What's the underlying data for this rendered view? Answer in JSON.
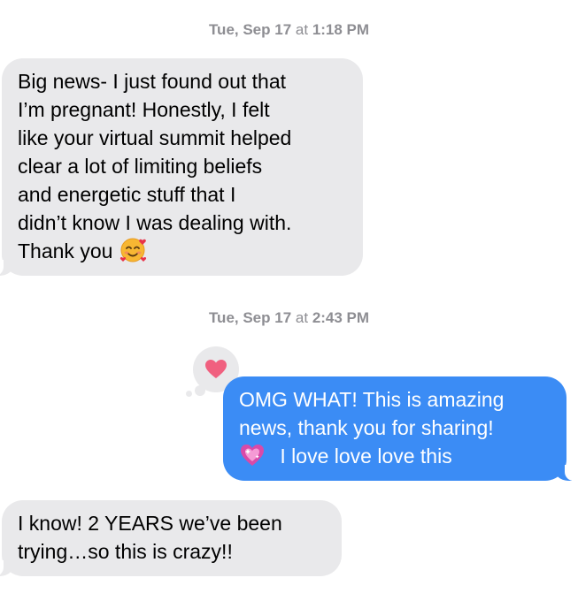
{
  "conversation": {
    "timestamps": [
      {
        "day": "Tue, Sep 17",
        "at": "at",
        "time": "1:18 PM"
      },
      {
        "day": "Tue, Sep 17",
        "at": "at",
        "time": "2:43 PM"
      }
    ],
    "messages": [
      {
        "direction": "received",
        "lines": [
          "Big news- I just found out that",
          "I’m pregnant! Honestly, I felt",
          "like your virtual summit helped",
          "clear a lot of limiting beliefs",
          "and energetic stuff that I",
          "didn’t know I was dealing with.",
          "Thank you"
        ],
        "trailing_emoji": "smiling-face-with-hearts-icon"
      },
      {
        "direction": "sent",
        "lines": [
          "OMG WHAT! This is amazing",
          "news, thank you for sharing!",
          "I love love love this"
        ],
        "leading_emoji": "sparkling-heart-icon",
        "tapback": "heart-icon"
      },
      {
        "direction": "received",
        "lines": [
          "I know! 2 YEARS we’ve been",
          "trying…so this is crazy!!"
        ]
      }
    ]
  },
  "colors": {
    "received_bubble": "#e9e9eb",
    "sent_bubble": "#3b8cf5",
    "timestamp_text": "#8e8e93",
    "tapback_heart": "#f0607f"
  }
}
